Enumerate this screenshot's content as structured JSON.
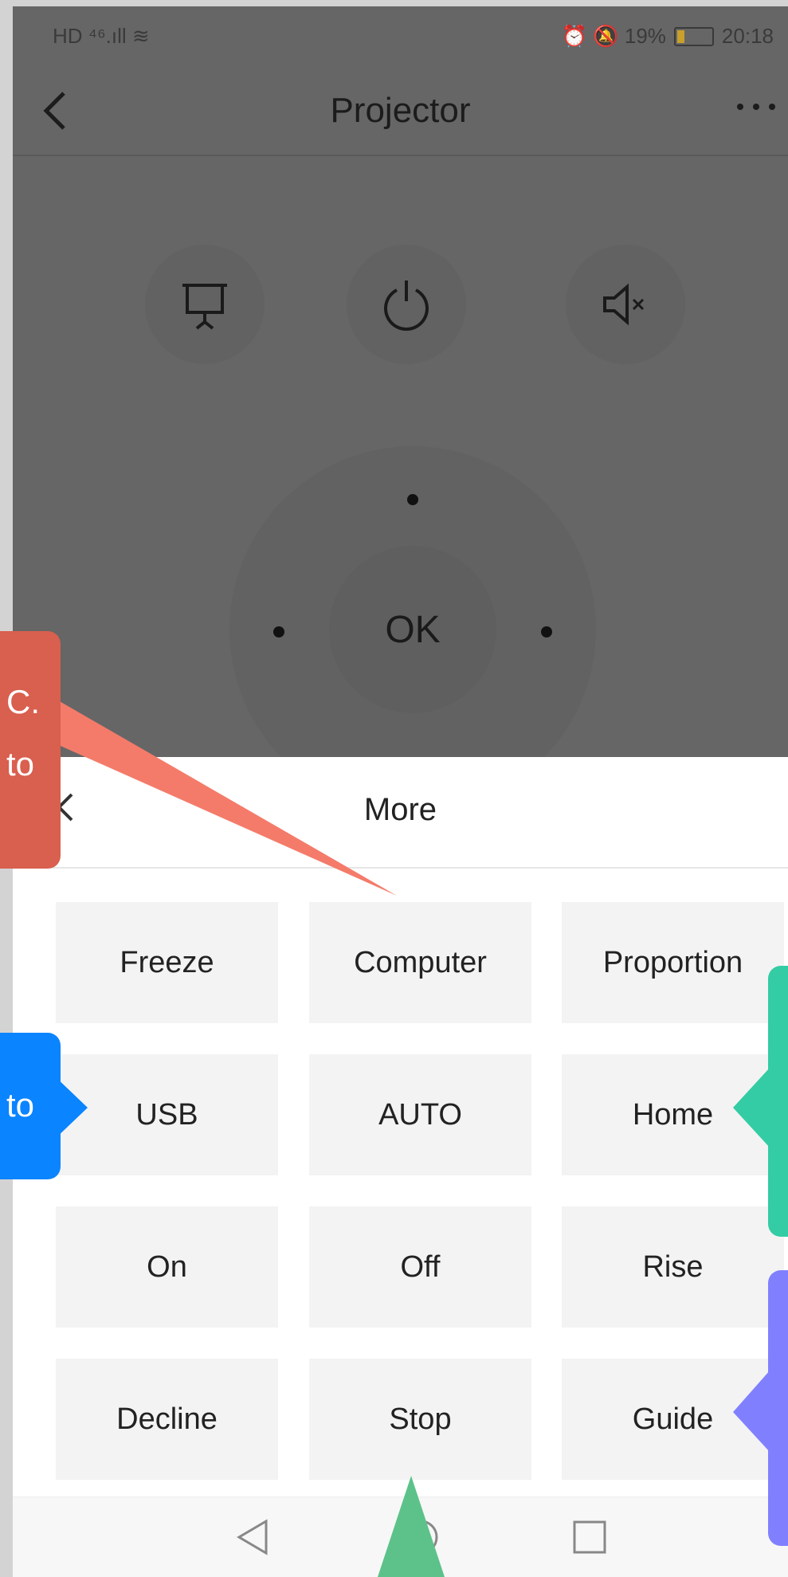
{
  "status_bar": {
    "left_indicators": "HD ⁴⁶.ıll ≋",
    "right_indicators": "⏰ 🔕 19%",
    "time": "20:18"
  },
  "header": {
    "title": "Projector",
    "back_icon": "chevron-left-icon",
    "menu_icon": "more-horizontal-icon"
  },
  "remote": {
    "top_buttons": [
      {
        "name": "projector-screen-button",
        "icon": "projector-screen-icon"
      },
      {
        "name": "power-button",
        "icon": "power-icon"
      },
      {
        "name": "mute-button",
        "icon": "volume-mute-icon"
      }
    ],
    "ok_label": "OK"
  },
  "sheet": {
    "title": "More",
    "close_icon": "close-icon",
    "options": [
      "Freeze",
      "Computer",
      "Proportion",
      "USB",
      "AUTO",
      "Home",
      "On",
      "Off",
      "Rise",
      "Decline",
      "Stop",
      "Guide"
    ]
  },
  "navbar": {
    "back_icon": "triangle-back-icon",
    "home_icon": "circle-home-icon",
    "recents_icon": "square-recents-icon"
  },
  "annotations": {
    "red_callout": [
      "C.",
      "to"
    ],
    "blue_callout": [
      "to"
    ],
    "colors": {
      "red": "#d95f4e",
      "salmon": "#f47b6a",
      "blue": "#0a84ff",
      "teal": "#33cca4",
      "purple": "#8080ff",
      "green": "#5cc28a"
    }
  }
}
